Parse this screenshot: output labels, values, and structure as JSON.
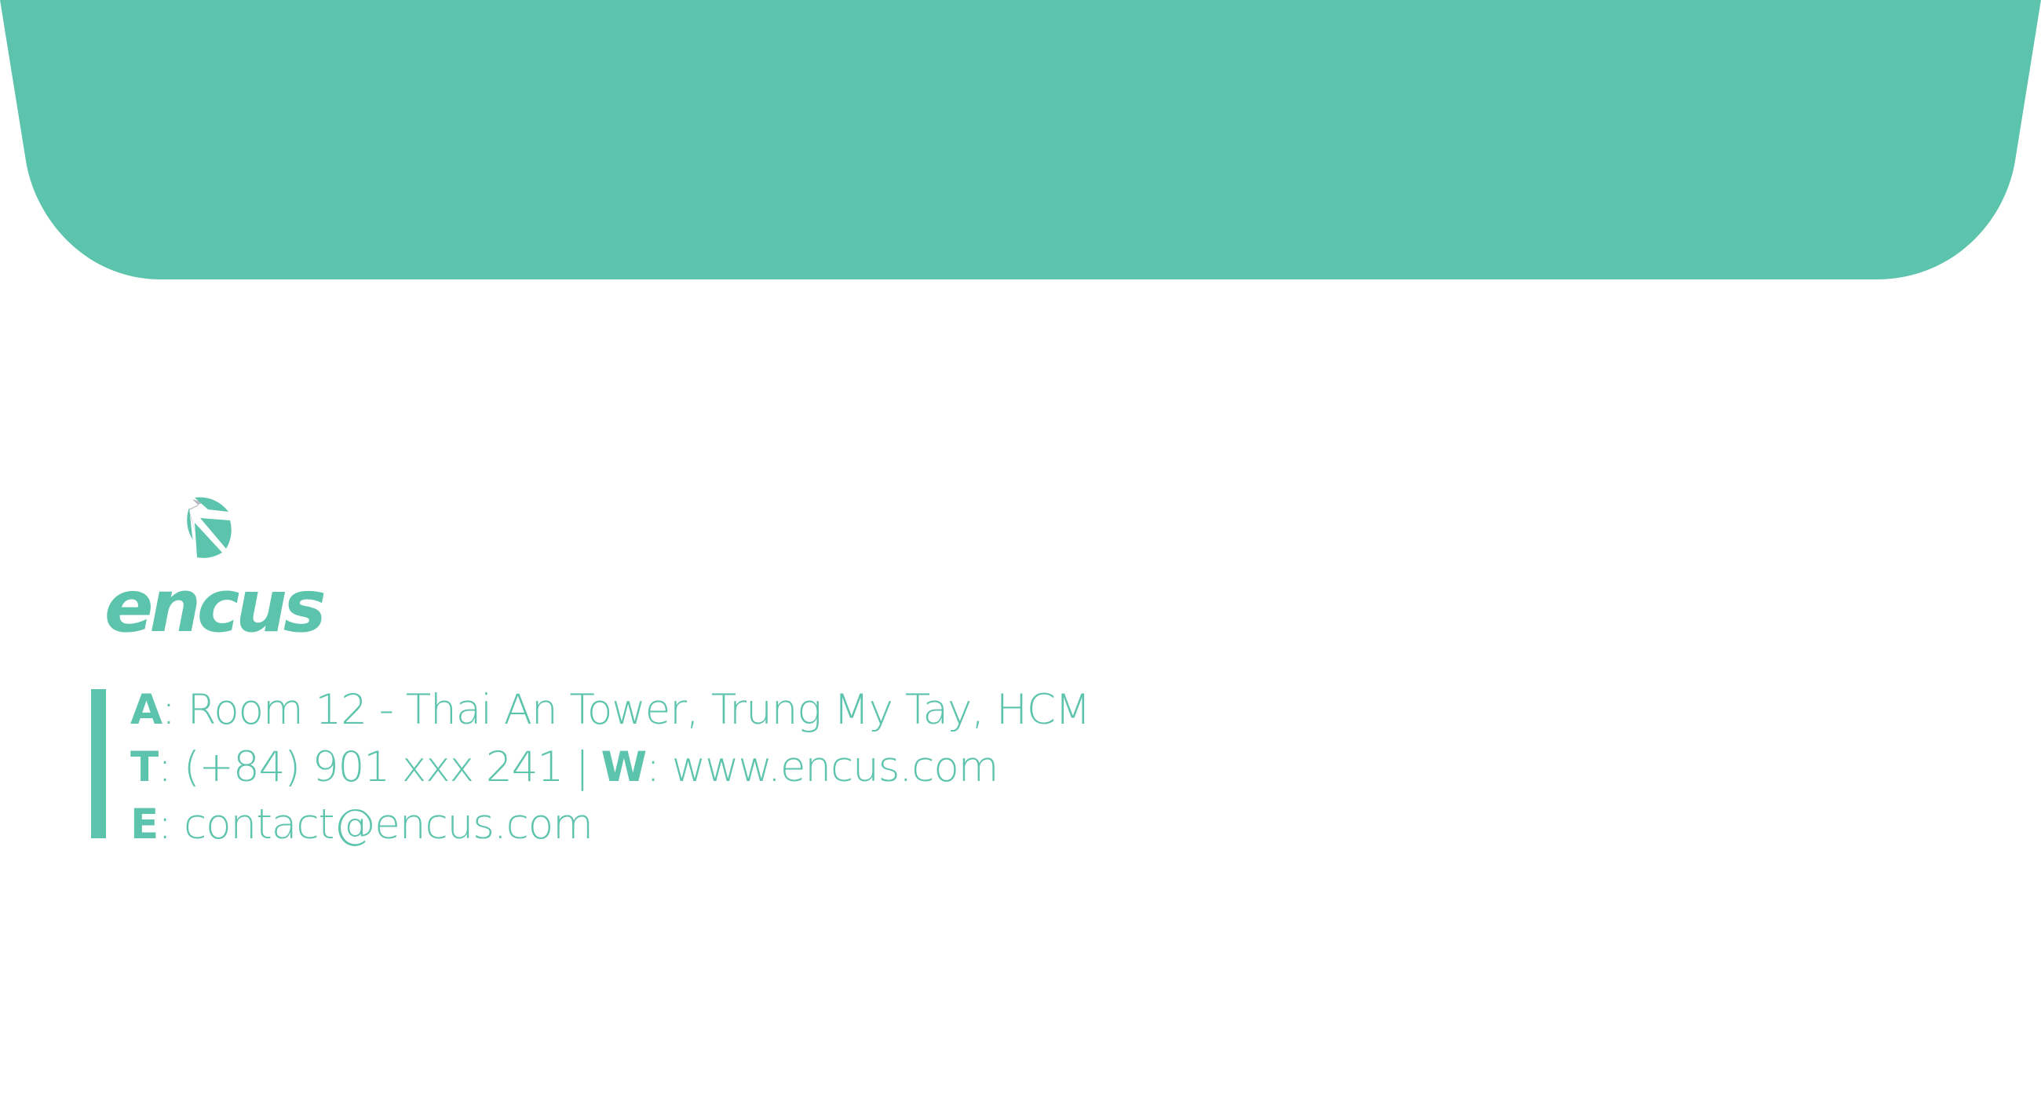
{
  "colors": {
    "brand": "#5CC3AC",
    "logo_gray": "#B7B8C3",
    "background": "#FFFFFF"
  },
  "brand": {
    "name": "encus"
  },
  "contact": {
    "address": {
      "label": "A",
      "separator": ": ",
      "value": "Room 12 - Thai An Tower, Trung My Tay, HCM"
    },
    "phone": {
      "label": "T",
      "separator": ": ",
      "value": "(+84) 901 xxx 241"
    },
    "divider": " | ",
    "website": {
      "label": "W",
      "separator": ": ",
      "value": "www.encus.com"
    },
    "email": {
      "label": "E",
      "separator": ": ",
      "value": "contact@encus.com"
    }
  }
}
